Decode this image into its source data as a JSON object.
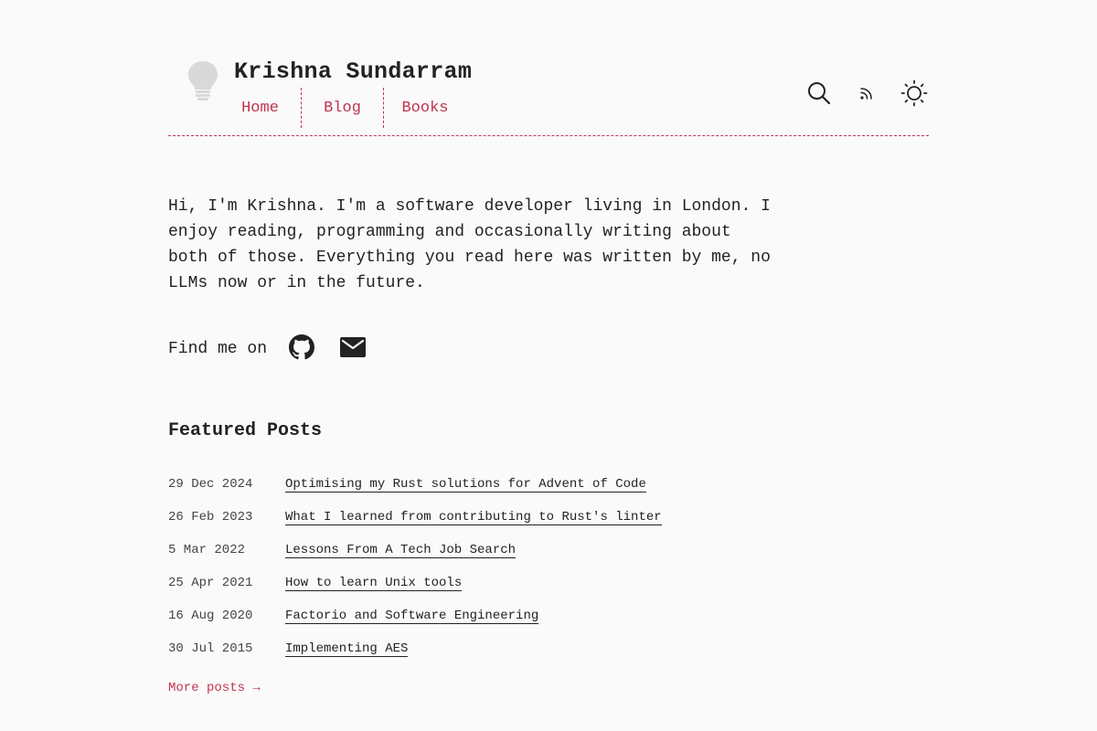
{
  "header": {
    "title": "Krishna Sundarram",
    "logo_icon": "lightbulb-icon",
    "nav": [
      {
        "label": "Home"
      },
      {
        "label": "Blog"
      },
      {
        "label": "Books"
      }
    ],
    "icons": [
      "search-icon",
      "rss-icon",
      "sun-icon"
    ]
  },
  "intro": {
    "text": "Hi, I'm Krishna. I'm a software developer living in London. I enjoy reading, programming and occasionally writing about both of those. Everything you read here was written by me, no LLMs now or in the future."
  },
  "find_me": {
    "label": "Find me on",
    "icons": [
      "github-icon",
      "mail-icon"
    ]
  },
  "featured": {
    "title": "Featured Posts",
    "posts": [
      {
        "date": "29 Dec 2024",
        "title": "Optimising my Rust solutions for Advent of Code"
      },
      {
        "date": "26 Feb 2023",
        "title": "What I learned from contributing to Rust's linter"
      },
      {
        "date": "5 Mar 2022",
        "title": "Lessons From A Tech Job Search"
      },
      {
        "date": "25 Apr 2021",
        "title": "How to learn Unix tools"
      },
      {
        "date": "16 Aug 2020",
        "title": "Factorio and Software Engineering"
      },
      {
        "date": "30 Jul 2015",
        "title": "Implementing AES"
      }
    ],
    "more_label": "More posts →"
  },
  "colors": {
    "accent": "#c0324f",
    "text": "#222222",
    "background": "#fafafa"
  }
}
